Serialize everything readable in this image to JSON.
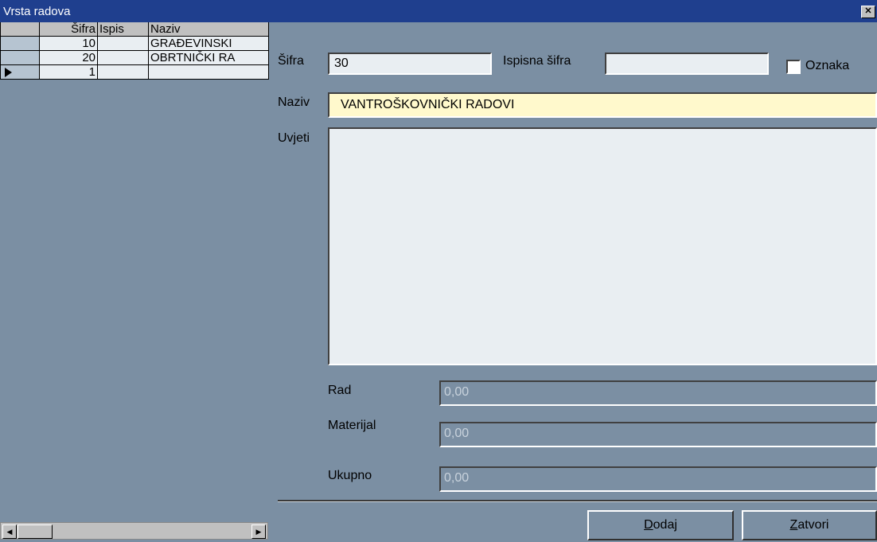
{
  "window": {
    "title": "Vrsta radova"
  },
  "grid": {
    "columns": [
      "Šifra",
      "Ispis",
      "Naziv"
    ],
    "rows": [
      {
        "sifra": "10",
        "ispis": "",
        "naziv": "GRAĐEVINSKI"
      },
      {
        "sifra": "20",
        "ispis": "",
        "naziv": "OBRTNIČKI RA"
      },
      {
        "sifra": "1",
        "ispis": "",
        "naziv": ""
      }
    ]
  },
  "form": {
    "sifra_label": "Šifra",
    "sifra_value": "30",
    "ispisna_sifra_label": "Ispisna šifra",
    "ispisna_sifra_value": "",
    "oznaka_label": "Oznaka",
    "naziv_label": "Naziv",
    "naziv_value": "VANTROŠKOVNIČKI RADOVI",
    "uvjeti_label": "Uvjeti",
    "uvjeti_value": "",
    "rad_label": "Rad",
    "rad_value": "0,00",
    "materijal_label": "Materijal",
    "materijal_value": "0,00",
    "ukupno_label": "Ukupno",
    "ukupno_value": "0,00"
  },
  "buttons": {
    "dodaj_mnemonic": "D",
    "dodaj_rest": "odaj",
    "zatvori_mnemonic": "Z",
    "zatvori_rest": "atvori"
  },
  "colors": {
    "titlebar": "#1f3f8e",
    "background": "#7b8fa3",
    "active_field": "#fff9cc"
  }
}
